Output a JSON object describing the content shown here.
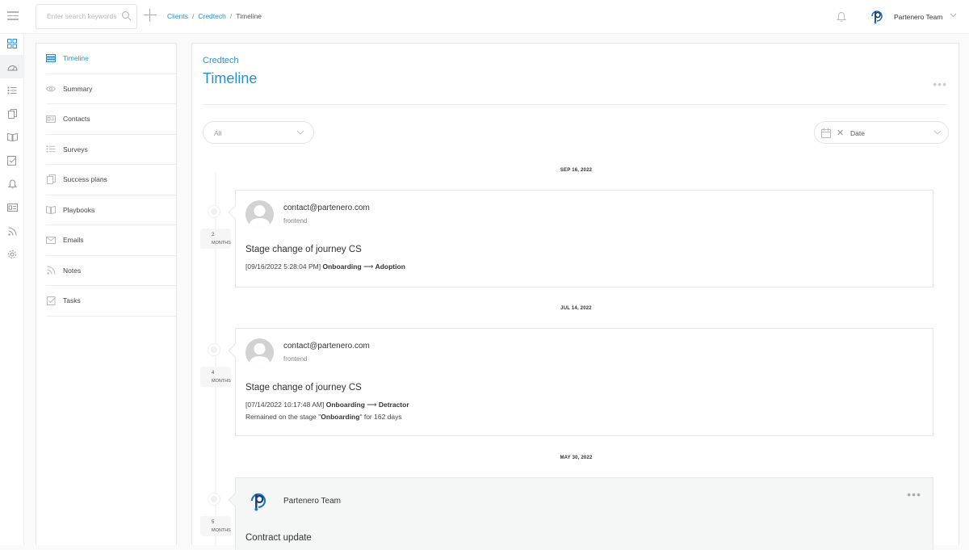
{
  "search": {
    "placeholder": "Enter search keywords"
  },
  "breadcrumb": {
    "items": [
      "Clients",
      "Credtech",
      "Timeline"
    ],
    "separator": "/"
  },
  "user": {
    "name": "Partenero Team"
  },
  "colors": {
    "accent": "#2a8fd0",
    "text": "#333333",
    "muted": "#888888"
  },
  "rail": {
    "icons": [
      "dashboard-icon",
      "dashboard-gauge-icon",
      "list-icon",
      "documents-icon",
      "book-icon",
      "checklist-icon",
      "bell-icon",
      "id-card-icon",
      "feed-icon",
      "gear-icon"
    ]
  },
  "subnav": {
    "items": [
      {
        "label": "Timeline",
        "icon": "timeline-icon",
        "active": true
      },
      {
        "label": "Summary",
        "icon": "eye-icon"
      },
      {
        "label": "Contacts",
        "icon": "id-card-icon"
      },
      {
        "label": "Surveys",
        "icon": "list-icon"
      },
      {
        "label": "Success plans",
        "icon": "documents-icon"
      },
      {
        "label": "Playbooks",
        "icon": "book-icon"
      },
      {
        "label": "Emails",
        "icon": "envelope-icon"
      },
      {
        "label": "Notes",
        "icon": "feed-icon"
      },
      {
        "label": "Tasks",
        "icon": "checklist-icon"
      }
    ]
  },
  "main": {
    "client": "Credtech",
    "title": "Timeline",
    "filters": {
      "type_value": "All",
      "date_placeholder": "Date"
    }
  },
  "timeline": [
    {
      "date": "SEP 16, 2022",
      "age_num": "2",
      "age_unit": "MONTHS",
      "author": "contact@partenero.com",
      "source": "frontend",
      "title": "Stage change of journey CS",
      "detail_prefix": "[09/16/2022 5:28:04 PM]",
      "from_stage": "Onboarding",
      "arrow": "⟶",
      "to_stage": "Adoption"
    },
    {
      "date": "JUL 14, 2022",
      "age_num": "4",
      "age_unit": "MONTHS",
      "author": "contact@partenero.com",
      "source": "frontend",
      "title": "Stage change of journey CS",
      "detail_prefix": "[07/14/2022 10:17:48 AM]",
      "from_stage": "Onboarding",
      "arrow": "⟶",
      "to_stage": "Detractor",
      "remained_prefix": "Remained on the stage \"",
      "remained_stage": "Onboarding",
      "remained_suffix": "\" for 162 days"
    },
    {
      "date": "MAY 30, 2022",
      "age_num": "5",
      "age_unit": "MONTHS",
      "author": "Partenero Team",
      "title": "Contract update",
      "menu": "•••"
    }
  ]
}
